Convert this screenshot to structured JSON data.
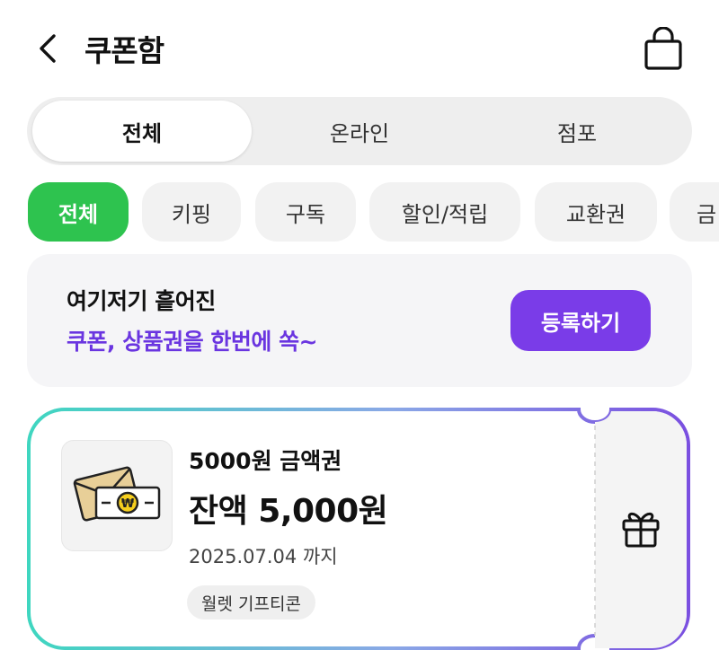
{
  "header": {
    "title": "쿠폰함",
    "back_icon": "chevron-left-icon",
    "bag_icon": "shopping-bag-icon"
  },
  "segments": [
    {
      "label": "전체",
      "active": true
    },
    {
      "label": "온라인",
      "active": false
    },
    {
      "label": "점포",
      "active": false
    }
  ],
  "chips": [
    {
      "label": "전체",
      "active": true
    },
    {
      "label": "키핑",
      "active": false
    },
    {
      "label": "구독",
      "active": false
    },
    {
      "label": "할인/적립",
      "active": false
    },
    {
      "label": "교환권",
      "active": false
    },
    {
      "label": "금",
      "active": false
    }
  ],
  "banner": {
    "line1": "여기저기 흩어진",
    "line2": "쿠폰, 상품권을 한번에 쏙~",
    "button": "등록하기"
  },
  "coupon": {
    "name": "5000원 금액권",
    "balance": "잔액 5,000원",
    "expiry": "2025.07.04 까지",
    "badge": "월렛 기프티콘",
    "thumbnail_icon": "cash-envelope-icon",
    "action_icon": "gift-icon"
  },
  "colors": {
    "accent_green": "#2ec34f",
    "accent_purple": "#7a3ce8",
    "banner_purple_text": "#6a35e0",
    "gradient_start": "#3fd6c0",
    "gradient_end": "#7a4fe0"
  }
}
